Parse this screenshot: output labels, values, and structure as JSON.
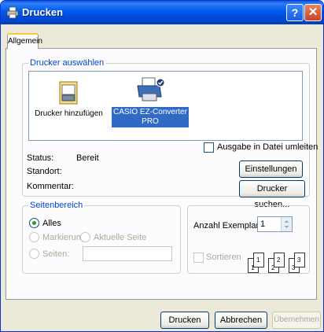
{
  "window": {
    "title": "Drucken",
    "help_label": "?",
    "close_label": "✕"
  },
  "tabs": [
    {
      "label": "Allgemein",
      "active": true
    }
  ],
  "printer_group": {
    "legend": "Drucker auswählen",
    "printers": [
      {
        "name": "Drucker hinzufügen",
        "icon": "add-printer-icon",
        "selected": false
      },
      {
        "name_line1": "CASIO EZ-Converter",
        "name_line2": "PRO",
        "icon": "printer-default-icon",
        "selected": true
      }
    ],
    "status_label": "Status:",
    "status_value": "Bereit",
    "location_label": "Standort:",
    "comment_label": "Kommentar:",
    "print_to_file_label": "Ausgabe in Datei umleiten",
    "preferences_button": "Einstellungen",
    "find_printer_button": "Drucker suchen..."
  },
  "page_range": {
    "legend": "Seitenbereich",
    "all_label": "Alles",
    "selection_label": "Markierung",
    "current_page_label": "Aktuelle Seite",
    "pages_label": "Seiten:",
    "pages_value": ""
  },
  "copies": {
    "label": "Anzahl Exemplare:",
    "value": "1",
    "collate_label": "Sortieren",
    "collate_pages": [
      "1",
      "1",
      "2",
      "2",
      "3",
      "3"
    ]
  },
  "footer": {
    "print_button": "Drucken",
    "cancel_button": "Abbrechen",
    "apply_button": "Übernehmen"
  },
  "colors": {
    "titlebar": "#0058ee",
    "dialog_bg": "#ece9d8",
    "group_legend": "#0046d5",
    "selection": "#316ac5"
  }
}
